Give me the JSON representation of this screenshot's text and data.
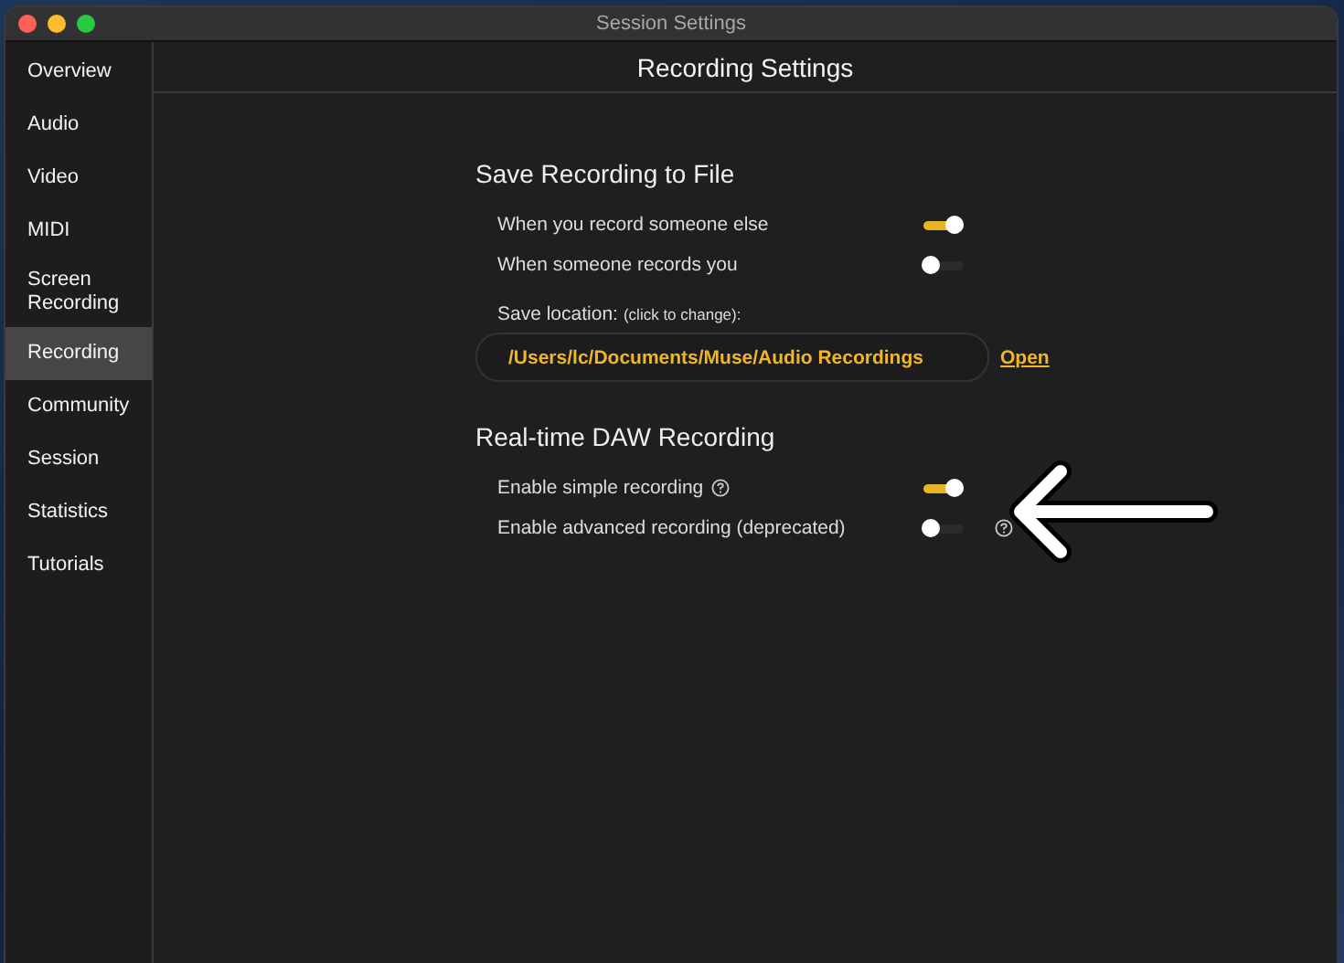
{
  "window": {
    "title": "Session Settings"
  },
  "sidebar": {
    "items": [
      {
        "label": "Overview",
        "selected": false
      },
      {
        "label": "Audio",
        "selected": false
      },
      {
        "label": "Video",
        "selected": false
      },
      {
        "label": "MIDI",
        "selected": false
      },
      {
        "label": "Screen Recording",
        "selected": false
      },
      {
        "label": "Recording",
        "selected": true
      },
      {
        "label": "Community",
        "selected": false
      },
      {
        "label": "Session",
        "selected": false
      },
      {
        "label": "Statistics",
        "selected": false
      },
      {
        "label": "Tutorials",
        "selected": false
      }
    ]
  },
  "header": {
    "title": "Recording Settings"
  },
  "sections": [
    {
      "title": "Save Recording to File",
      "toggles": [
        {
          "label": "When you record someone else",
          "on": true
        },
        {
          "label": "When someone records you",
          "on": false
        }
      ],
      "location": {
        "label": "Save location:",
        "hint": "(click to change):",
        "value": "/Users/lc/Documents/Muse/Audio Recordings",
        "link": "Open"
      }
    },
    {
      "title": "Real-time DAW Recording",
      "toggles": [
        {
          "label": "Enable simple recording",
          "on": true,
          "kind": "inline-help"
        },
        {
          "label": "Enable advanced recording (deprecated)",
          "on": false,
          "kind": "trailing-help"
        }
      ]
    }
  ]
}
